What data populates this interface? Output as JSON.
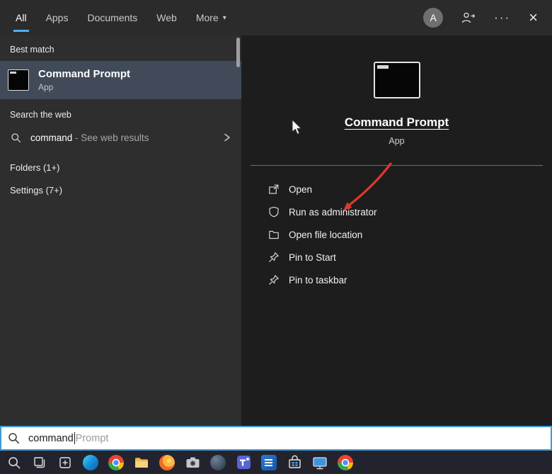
{
  "colors": {
    "topbar_bg": "#2b2b2b",
    "left_panel_bg": "#2e2e2e",
    "right_panel_bg": "#1d1d1d",
    "taskbar_bg": "#23232e",
    "tab_underline": "#4cb1e8",
    "best_match_highlight": "#404a59",
    "annotation_arrow": "#df382d",
    "search_box_border": "#3f9bd8"
  },
  "tabs": {
    "items": [
      {
        "label": "All",
        "selected": true
      },
      {
        "label": "Apps",
        "selected": false
      },
      {
        "label": "Documents",
        "selected": false
      },
      {
        "label": "Web",
        "selected": false
      },
      {
        "label": "More",
        "selected": false
      }
    ],
    "caret": "▾"
  },
  "topbar": {
    "avatar_letter": "A",
    "ellipsis_label": "···",
    "close_label": "×"
  },
  "left_panel": {
    "best_match_header": "Best match",
    "best_match": {
      "title": "Command Prompt",
      "subtitle": "App"
    },
    "search_web_header": "Search the web",
    "web_suggestion": {
      "query": "command",
      "suffix": " - See web results"
    },
    "folders_header": "Folders (1+)",
    "settings_header": "Settings (7+)"
  },
  "right_panel": {
    "app_title": "Command Prompt",
    "app_subtitle": "App",
    "actions": [
      {
        "label": "Open",
        "icon": "open-icon"
      },
      {
        "label": "Run as administrator",
        "icon": "shield-icon"
      },
      {
        "label": "Open file location",
        "icon": "folder-icon"
      },
      {
        "label": "Pin to Start",
        "icon": "pin-icon"
      },
      {
        "label": "Pin to taskbar",
        "icon": "pin-icon"
      }
    ]
  },
  "search_bar": {
    "typed_text": "command",
    "suggestion_text": "Prompt"
  },
  "taskbar": {
    "icons": [
      "search-icon",
      "task-view-icon",
      "plus-square-icon",
      "edge-icon",
      "chrome-icon",
      "file-explorer-icon",
      "firefox-icon",
      "camera-icon",
      "dark-app-icon",
      "teams-icon",
      "word-icon",
      "store-icon",
      "display-icon",
      "chrome-icon-2"
    ]
  }
}
